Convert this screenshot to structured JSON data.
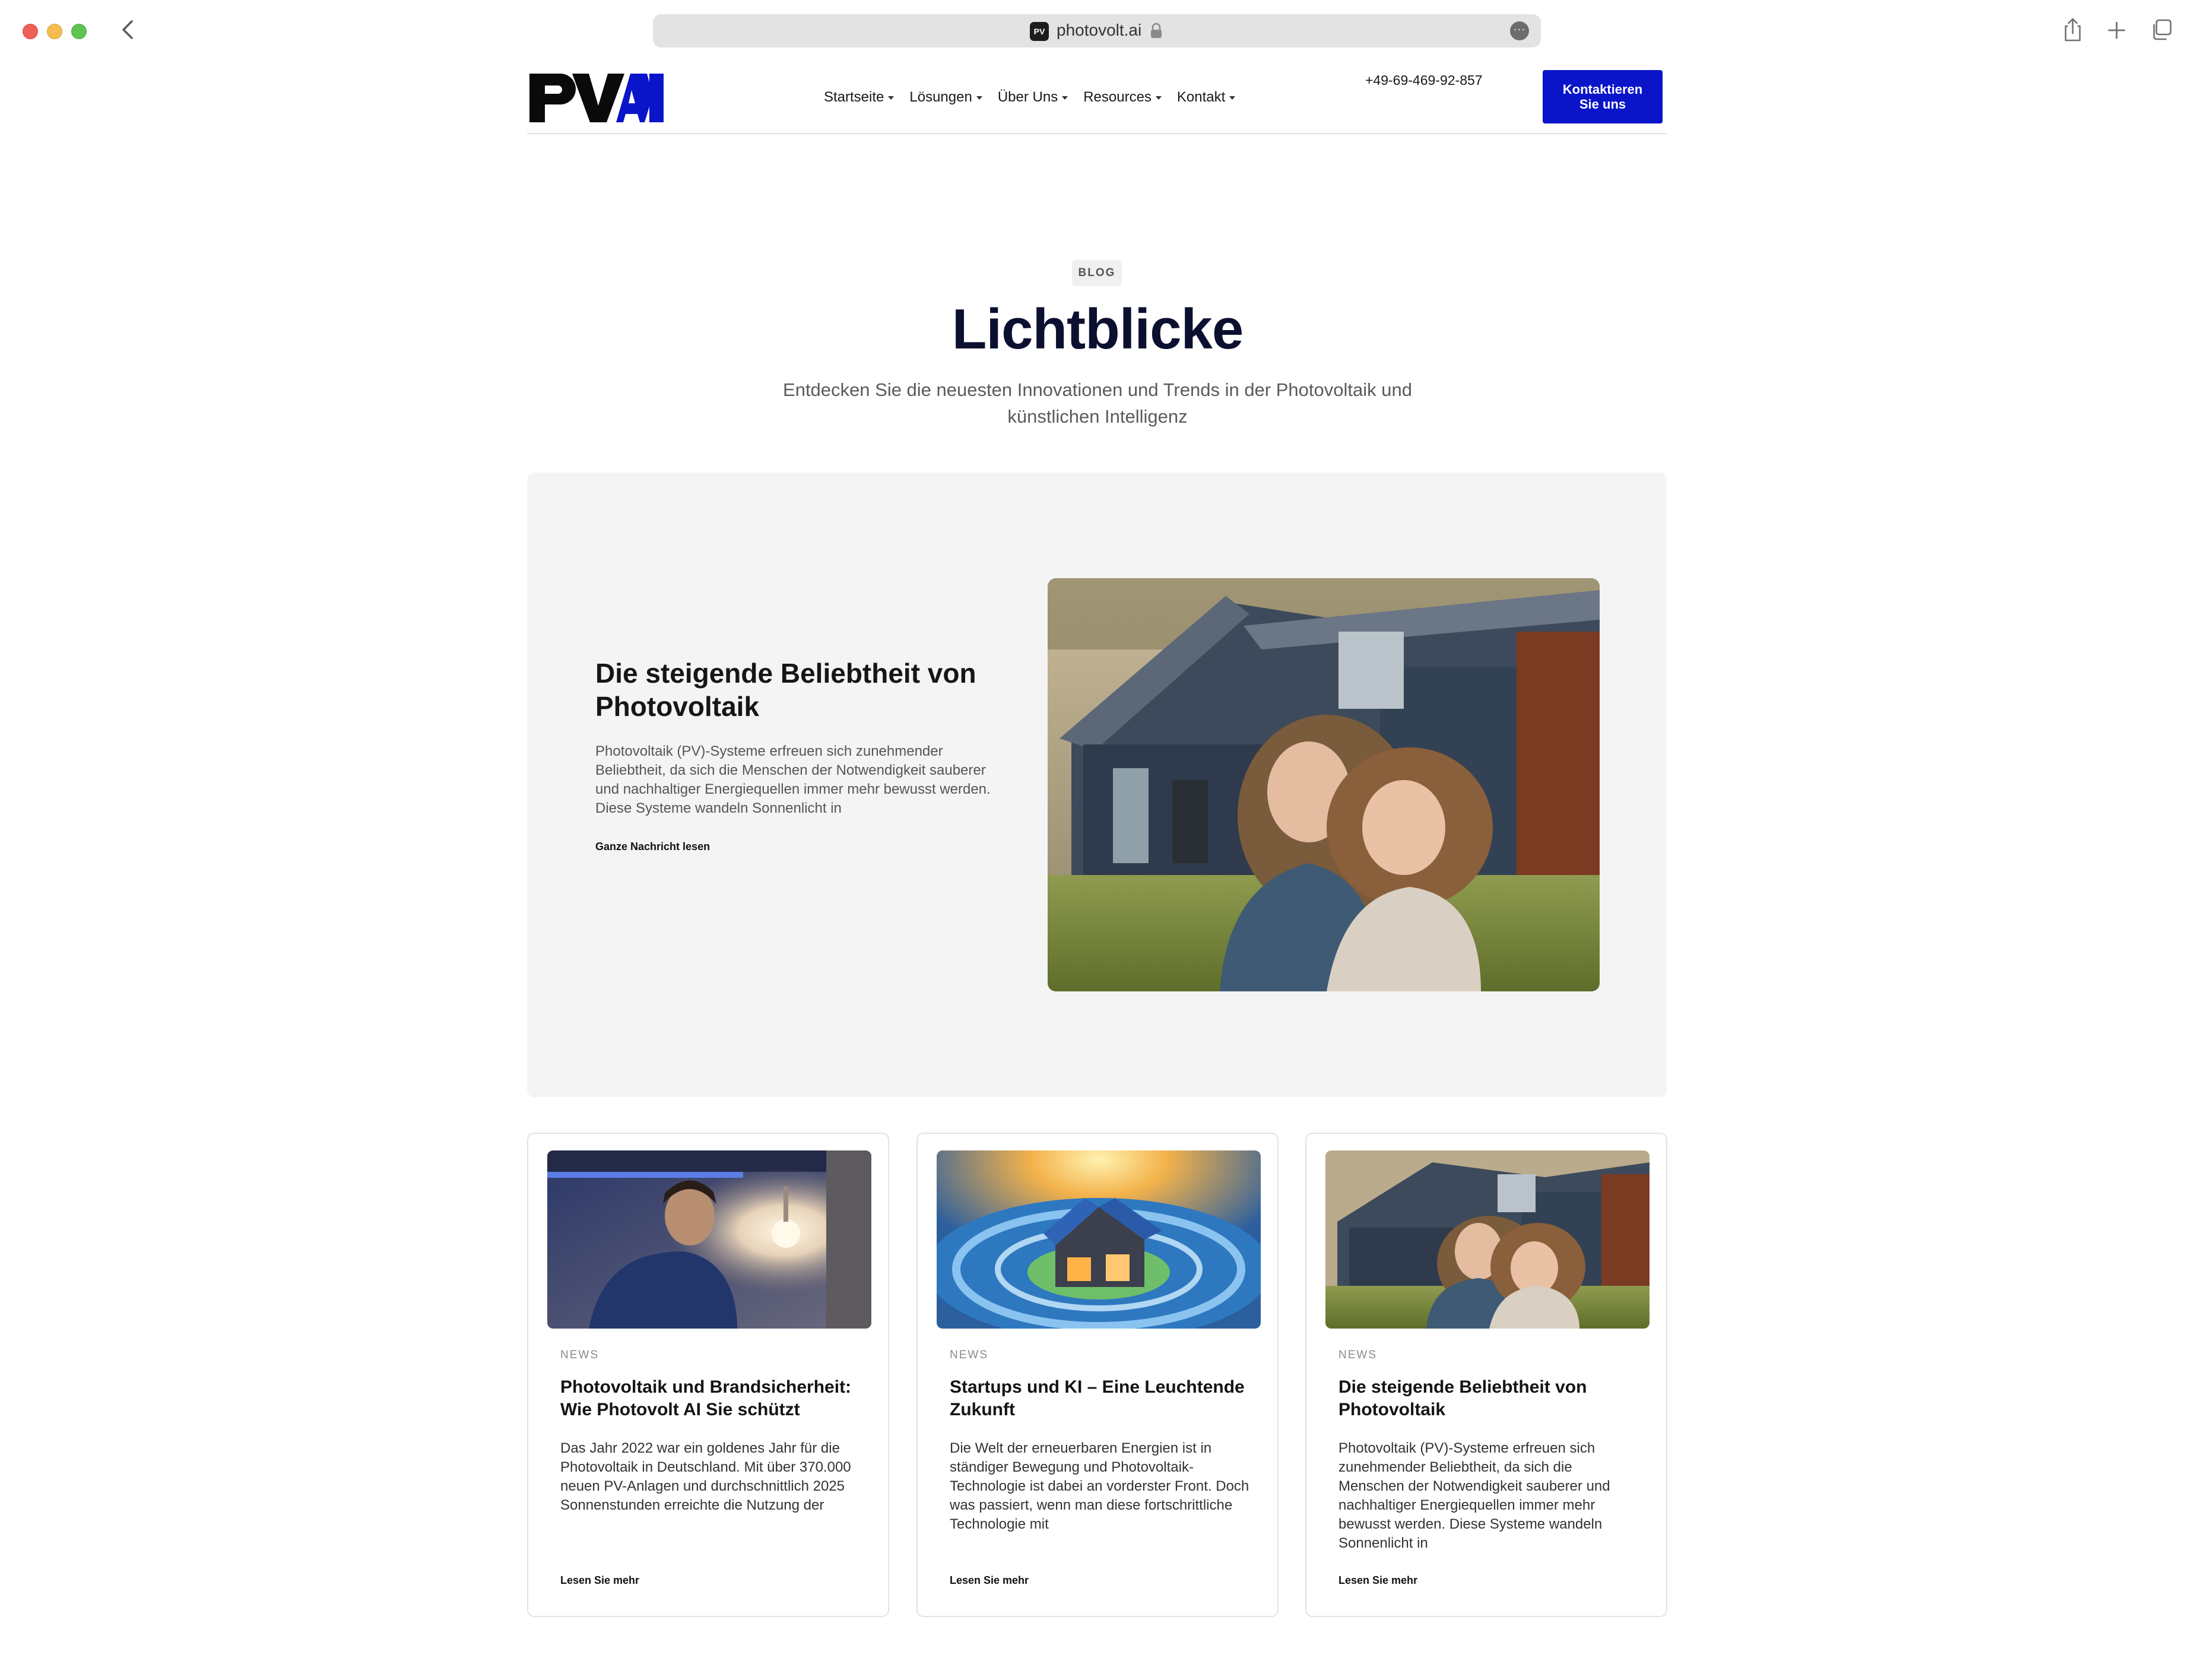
{
  "browser": {
    "url": "photovolt.ai",
    "favicon_text": "PV"
  },
  "header": {
    "logo_text": "PVAI",
    "nav": [
      {
        "label": "Startseite"
      },
      {
        "label": "Lösungen"
      },
      {
        "label": "Über Uns"
      },
      {
        "label": "Resources"
      },
      {
        "label": "Kontakt"
      }
    ],
    "phone": "+49-69-469-92-857",
    "cta_label": "Kontaktieren Sie uns"
  },
  "hero": {
    "badge": "BLOG",
    "title": "Lichtblicke",
    "subtitle": "Entdecken Sie die neuesten Innovationen und Trends in der Photovoltaik und künstlichen Intelligenz"
  },
  "featured": {
    "title": "Die steigende Beliebtheit von Photovoltaik",
    "excerpt": "Photovoltaik (PV)-Systeme erfreuen sich zunehmender Beliebtheit, da sich die Menschen der Notwendigkeit sauberer und nachhaltiger Energiequellen immer mehr bewusst werden. Diese Systeme wandeln Sonnenlicht in",
    "link_label": "Ganze Nachricht lesen"
  },
  "posts": [
    {
      "category": "NEWS",
      "title": "Photovoltaik und Brandsicherheit: Wie Photovolt AI Sie schützt",
      "excerpt": "Das Jahr 2022 war ein goldenes Jahr für die Photovoltaik in Deutschland. Mit über 370.000 neuen PV-Anlagen und durchschnittlich 2025 Sonnenstunden erreichte die Nutzung der",
      "link_label": "Lesen Sie mehr"
    },
    {
      "category": "NEWS",
      "title": "Startups und KI – Eine Leuchtende Zukunft",
      "excerpt": "Die Welt der erneuerbaren Energien ist in ständiger Bewegung und Photovoltaik-Technologie ist dabei an vorderster Front. Doch was passiert, wenn man diese fortschrittliche Technologie mit",
      "link_label": "Lesen Sie mehr"
    },
    {
      "category": "NEWS",
      "title": "Die steigende Beliebtheit von Photovoltaik",
      "excerpt": "Photovoltaik (PV)-Systeme erfreuen sich zunehmender Beliebtheit, da sich die Menschen der Notwendigkeit sauberer und nachhaltiger Energiequellen immer mehr bewusst werden. Diese Systeme wandeln Sonnenlicht in",
      "link_label": "Lesen Sie mehr"
    }
  ],
  "colors": {
    "brand_blue": "#0a14c9",
    "title_navy": "#0c1030",
    "panel_gray": "#f4f4f4"
  }
}
